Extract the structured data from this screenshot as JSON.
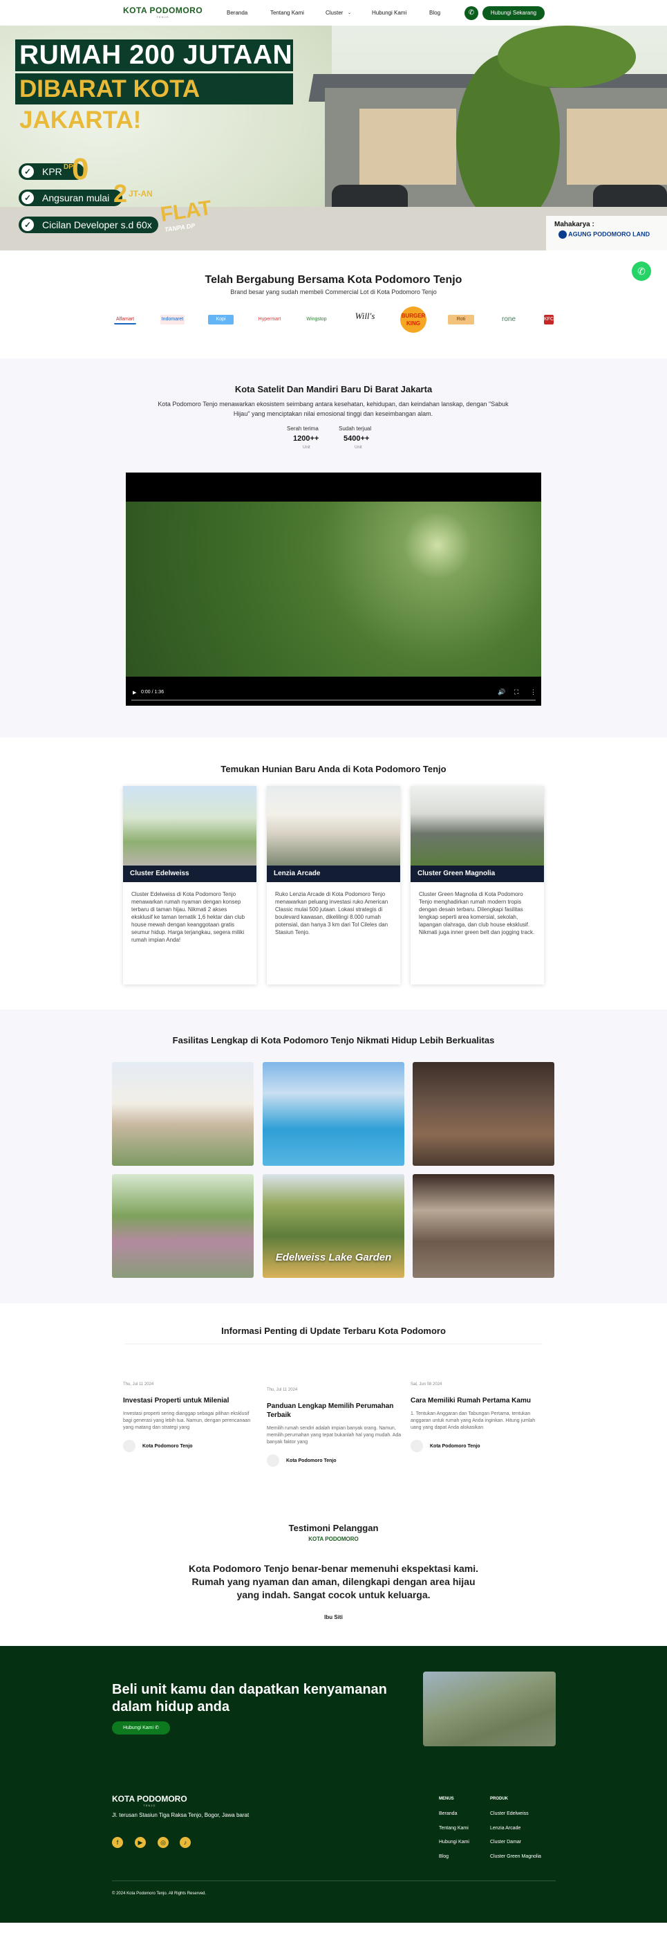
{
  "nav": {
    "logo": "KOTA PODOMORO",
    "logo_sub": "TENJO",
    "links": [
      "Beranda",
      "Tentang Kami",
      "Cluster",
      "Hubungi Kami",
      "Blog"
    ],
    "cta": "Hubungi Sekarang"
  },
  "hero": {
    "title_line1": "RUMAH 200 JUTAAN",
    "title_line2": "DIBARAT KOTA JAKARTA!",
    "kpr_label": "KPR",
    "kpr_value": "0",
    "dp_label": "DP",
    "angsuran_label": "Angsuran mulai",
    "angsuran_value": "2",
    "angsuran_unit": "JT-AN",
    "cicilan_label": "Cicilan Developer s.d 60x",
    "flat_label": "FLAT",
    "flat_sub": "TANPA DP",
    "developer_tag": "Mahakarya :",
    "developer_name": "AGUNG PODOMORO LAND"
  },
  "brands": {
    "title": "Telah Bergabung Bersama Kota Podomoro Tenjo",
    "subtitle": "Brand besar yang sudah membeli Commercial Lot di Kota Podomoro Tenjo",
    "items": [
      "Alfamart",
      "Indomaret",
      "Kopi",
      "Hypermart",
      "Wingstop",
      "Will's",
      "BURGER KING",
      "Roti",
      "rone",
      "KFC"
    ]
  },
  "about": {
    "title": "Kota Satelit Dan Mandiri Baru Di Barat Jakarta",
    "text": "Kota Podomoro Tenjo menawarkan ekosistem seimbang antara kesehatan, kehidupan, dan keindahan lanskap, dengan \"Sabuk Hijau\" yang menciptakan nilai emosional tinggi dan keseimbangan alam.",
    "stats": [
      {
        "label": "Serah terima",
        "value": "1200++",
        "unit": "Unit"
      },
      {
        "label": "Sudah terjual",
        "value": "5400++",
        "unit": "Unit"
      }
    ],
    "video_time": "0:00 / 1:36"
  },
  "clusters": {
    "title": "Temukan Hunian Baru Anda di Kota Podomoro Tenjo",
    "items": [
      {
        "name": "Cluster Edelweiss",
        "desc": "Cluster Edelweiss di Kota Podomoro Tenjo menawarkan rumah nyaman dengan konsep terbaru di taman hijau. Nikmati 2 akses eksklusif ke taman tematik 1,6 hektar dan club house mewah dengan keanggotaan gratis seumur hidup. Harga terjangkau, segera miliki rumah impian Anda!"
      },
      {
        "name": "Lenzia Arcade",
        "desc": "Ruko Lenzia Arcade di Kota Podomoro Tenjo menawarkan peluang investasi ruko American Classic mulai 500 jutaan. Lokasi strategis di boulevard kawasan, dikelilingi 8.000 rumah potensial, dan hanya 3 km dari Tol Cileles dan Stasiun Tenjo."
      },
      {
        "name": "Cluster Green Magnolia",
        "desc": "Cluster Green Magnolia di Kota Podomoro Tenjo menghadirkan rumah modern tropis dengan desain terbaru. Dilengkapi fasilitas lengkap seperti area komersial, sekolah, lapangan olahraga, dan club house eksklusif. Nikmati juga inner green belt dan jogging track."
      }
    ]
  },
  "facilities": {
    "title": "Fasilitas Lengkap di Kota Podomoro Tenjo Nikmati Hidup Lebih Berkualitas",
    "caption": "Edelweiss Lake Garden"
  },
  "blog": {
    "title": "Informasi Penting di Update Terbaru Kota Podomoro",
    "posts": [
      {
        "date": "Thu, Jul 11 2024",
        "title": "Investasi Properti untuk Milenial",
        "excerpt": "Investasi properti sering dianggap sebagai pilihan eksklusif bagi generasi yang lebih tua. Namun, dengan perencanaan yang matang dan strategi yang",
        "author": "Kota Podomoro Tenjo"
      },
      {
        "date": "Thu, Jul 11 2024",
        "title": "Panduan Lengkap Memilih Perumahan Terbaik",
        "excerpt": "Memilih rumah sendiri adalah impian banyak orang. Namun, memilih perumahan yang tepat bukanlah hal yang mudah. Ada banyak faktor yang",
        "author": "Kota Podomoro Tenjo"
      },
      {
        "date": "Sat, Jun 08 2024",
        "title": "Cara Memiliki Rumah Pertama Kamu",
        "excerpt": "1. Tentukan Anggaran dan Tabungan Pertama, tentukan anggaran untuk rumah yang Anda inginkan. Hitung jumlah uang yang dapat Anda alokasikan",
        "author": "Kota Podomoro Tenjo"
      }
    ]
  },
  "testimoni": {
    "title": "Testimoni Pelanggan",
    "quote": "Kota Podomoro Tenjo benar-benar memenuhi ekspektasi kami. Rumah yang nyaman dan aman, dilengkapi dengan area hijau yang indah. Sangat cocok untuk keluarga.",
    "by": "Ibu Siti"
  },
  "footer": {
    "cta_title": "Beli unit kamu dan dapatkan kenyamanan dalam hidup anda",
    "cta_button": "Hubungi Kami",
    "address": "Jl. terusan Stasiun Tiga Raksa Tenjo, Bogor, Jawa barat",
    "menu_title": "MENUS",
    "menu": [
      "Beranda",
      "Tentang Kami",
      "Hubungi Kami",
      "Blog"
    ],
    "produk_title": "PRODUK",
    "produk": [
      "Cluster Edelweiss",
      "Lenzia Arcade",
      "Cluster Damar",
      "Cluster Green Magnolia"
    ],
    "copyright": "© 2024 Kota Podomoro Tenjo. All Rights Reserved."
  },
  "colors": {
    "brand_green": "#0b5d1e",
    "footer_bg": "#053011",
    "gold": "#e9b93a",
    "whatsapp": "#25d366"
  }
}
